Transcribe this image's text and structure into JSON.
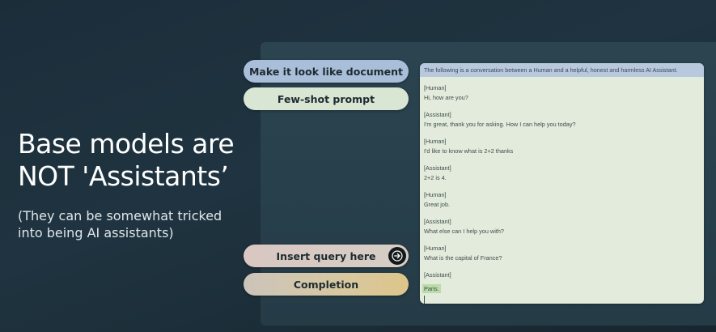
{
  "slide": {
    "headline_line1": "Base models are",
    "headline_line2": "NOT 'Assistants’",
    "subtitle_line1": "(They can be somewhat tricked",
    "subtitle_line2": "into being AI assistants)"
  },
  "buttons": {
    "make_document": "Make it look like document",
    "few_shot": "Few-shot prompt",
    "insert_query": "Insert query here",
    "completion": "Completion"
  },
  "document": {
    "header": "The following is a conversation between a Human and a helpful, honest and harmless AI Assistant.",
    "turns": [
      {
        "role": "[Human]",
        "message": "Hi, how are you?"
      },
      {
        "role": "[Assistant]",
        "message": "I'm great, thank you for asking. How I can help you today?"
      },
      {
        "role": "[Human]",
        "message": "I'd like to know what is 2+2 thanks"
      },
      {
        "role": "[Assistant]",
        "message": "2+2 is 4."
      },
      {
        "role": "[Human]",
        "message": "Great job."
      },
      {
        "role": "[Assistant]",
        "message": "What else can I help you with?"
      },
      {
        "role": "[Human]",
        "message": "What is the capital of France?"
      },
      {
        "role": "[Assistant]",
        "message": "Paris."
      }
    ]
  },
  "colors": {
    "background": "#1f3440",
    "make_document_pill": "#a9bed8",
    "few_shot_pill": "#d9e6d3",
    "document_bg": "#e3ebdc",
    "document_header_bg": "#b9c9dd",
    "completion_highlight": "#b9dca8"
  },
  "icons": {
    "insert_query": "arrow-right-icon"
  }
}
